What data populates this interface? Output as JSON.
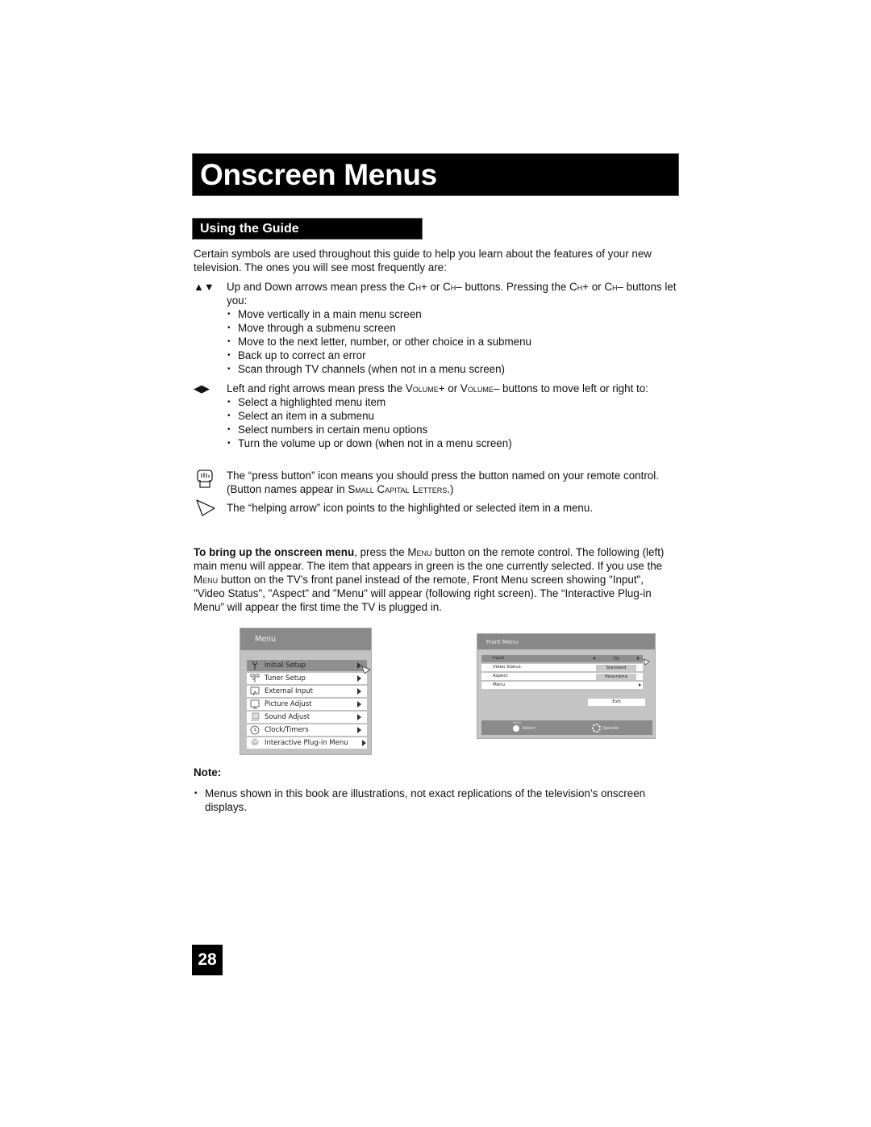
{
  "header": {
    "title": "Onscreen Menus"
  },
  "section": {
    "title": "Using the Guide"
  },
  "intro": "Certain symbols are used throughout this guide to help you learn about the features of your new television. The ones you will see most frequently are:",
  "symbols": {
    "updown": {
      "glyph": "▲▼",
      "text_a": "Up and Down arrows mean press the ",
      "ch1": "Ch",
      "ch1b": "+ or ",
      "ch2": "Ch",
      "ch2b": "– buttons. Pressing the ",
      "ch3": "Ch",
      "ch3b": "+ or ",
      "ch4": "Ch",
      "ch4b": "– buttons let you:",
      "bullets": [
        "Move vertically in a main menu screen",
        "Move through a submenu screen",
        "Move to the next letter, number, or other choice in a submenu",
        "Back up to correct an error",
        "Scan through TV channels (when not in a menu screen)"
      ]
    },
    "leftright": {
      "glyph": "◀▶",
      "text_a": "Left and right arrows mean press the ",
      "vol1": "Volume",
      "vol1b": "+ or  ",
      "vol2": "Volume",
      "vol2b": "– buttons to move left or right to:",
      "bullets": [
        "Select a highlighted menu item",
        "Select an item in a submenu",
        "Select numbers in certain menu options",
        "Turn the volume up or down (when not in a menu screen)"
      ]
    },
    "press": {
      "text_a": "The “press button” icon means you should press the button named on your remote control. (Button names appear in ",
      "sc": "Small Capital Letters.",
      "text_b": ")"
    },
    "helping": {
      "text": "The “helping arrow” icon points to the highlighted or selected item in a menu."
    }
  },
  "paragraph": {
    "bold": "To bring up the onscreen menu",
    "t1": ", press the ",
    "menu1": "Menu",
    "t2": " button on the remote control. The following (left) main menu will appear.  The item that appears in green is the one currently selected. If you use the ",
    "menu2": "Menu",
    "t3": " button on the TV’s front panel instead of the remote, Front Menu screen showing \"Input\", \"Video Status\", \"Aspect\" and \"Menu\" will appear (following right screen). The “Interactive Plug-in Menu” will appear the first time the TV is plugged in."
  },
  "main_menu": {
    "title": "Menu",
    "selected_index": 0,
    "items": [
      {
        "label": "Initial Setup",
        "icon": "wrench-icon"
      },
      {
        "label": "Tuner Setup",
        "icon": "antenna-icon"
      },
      {
        "label": "External Input",
        "icon": "input-icon"
      },
      {
        "label": "Picture Adjust",
        "icon": "monitor-icon"
      },
      {
        "label": "Sound Adjust",
        "icon": "speaker-icon"
      },
      {
        "label": "Clock/Timers",
        "icon": "clock-icon"
      },
      {
        "label": "Interactive Plug-in Menu",
        "icon": "plugin-icon"
      }
    ]
  },
  "front_menu": {
    "title": "Front Menu",
    "rows": [
      {
        "label": "Input",
        "value": "TV"
      },
      {
        "label": "Video Status",
        "value": "Standard"
      },
      {
        "label": "Aspect",
        "value": "Panorama"
      },
      {
        "label": "Menu",
        "value": ""
      }
    ],
    "exit": "Exit",
    "footer": {
      "menu_label": "MENU",
      "select": "Select",
      "operate": "Operate"
    }
  },
  "note": {
    "heading": "Note:",
    "bullets": [
      "Menus shown in this book are illustrations, not exact replications of the television’s onscreen displays."
    ]
  },
  "page_number": "28"
}
